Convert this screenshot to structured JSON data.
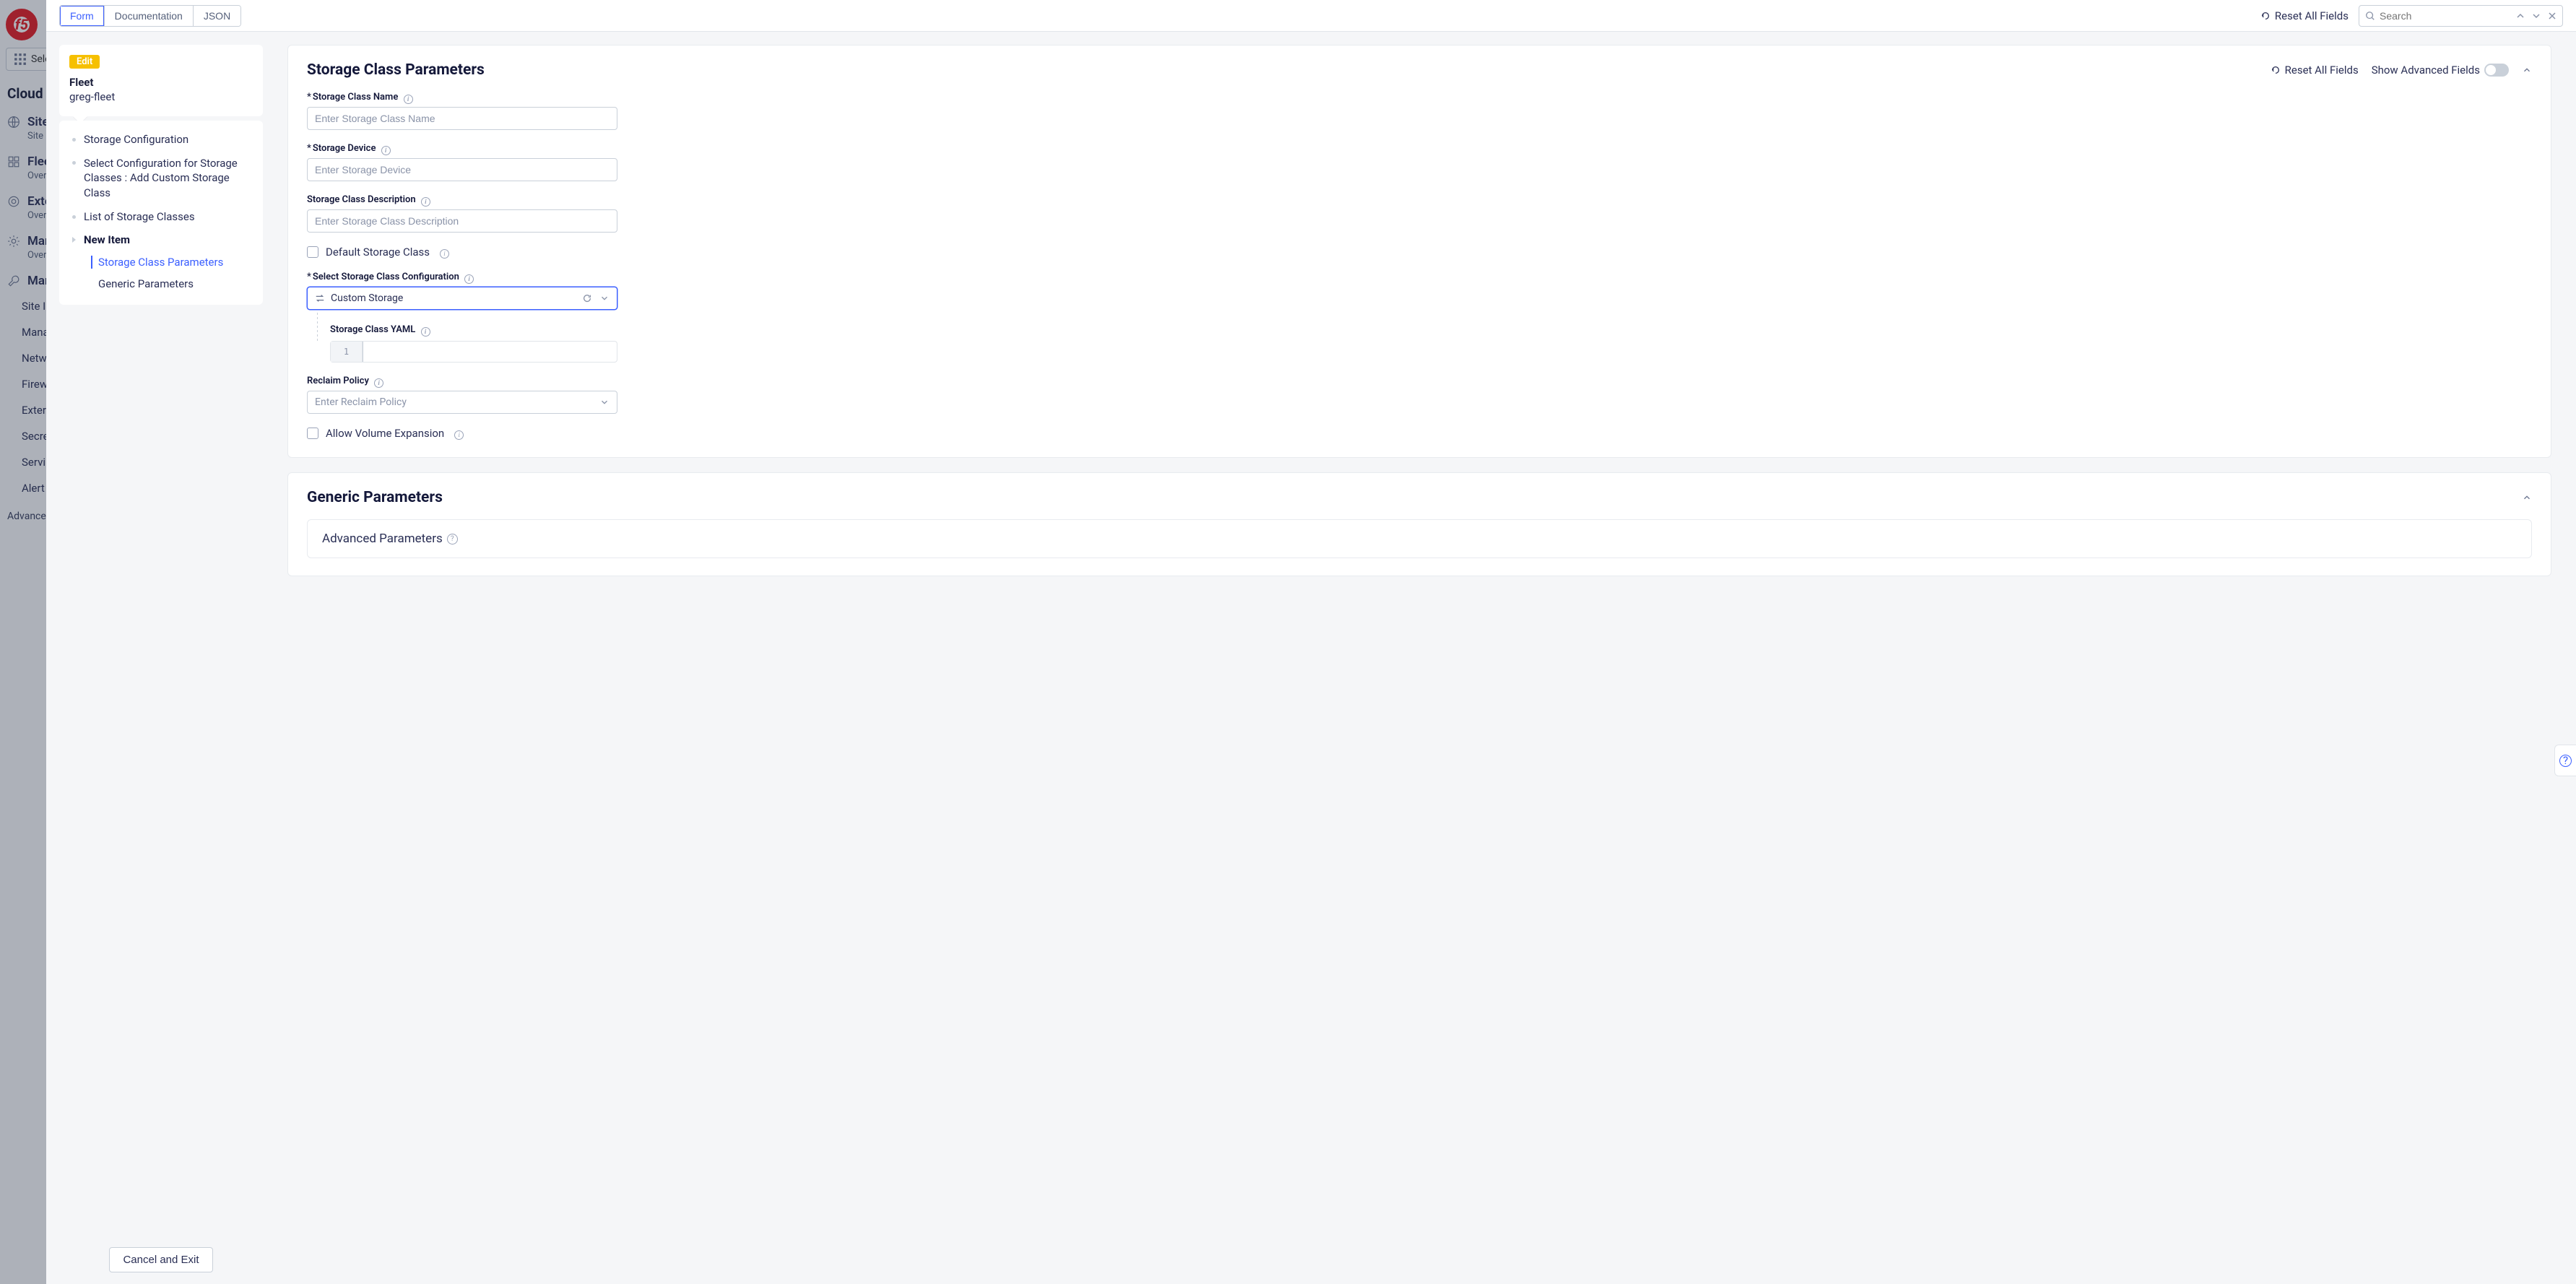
{
  "bg": {
    "select_label": "Sele",
    "heading": "Cloud a",
    "nav": [
      {
        "label": "Sites",
        "sub": "Site M"
      },
      {
        "label": "Flee",
        "sub": "Overv"
      },
      {
        "label": "Exte",
        "sub": "Overv"
      },
      {
        "label": "Man",
        "sub": "Overv"
      },
      {
        "label": "Man",
        "sub": ""
      }
    ],
    "plain": [
      "Site I",
      "Mana",
      "Netw",
      "Firew",
      "Exter",
      "Secre",
      "Servi",
      "Alert"
    ],
    "footer": "Advanced"
  },
  "toolbar": {
    "tabs": {
      "form": "Form",
      "documentation": "Documentation",
      "json": "JSON"
    },
    "reset": "Reset All Fields",
    "search_placeholder": "Search"
  },
  "tree": {
    "badge": "Edit",
    "title": "Fleet",
    "subtitle": "greg-fleet",
    "items": {
      "storage_config": "Storage Configuration",
      "select_config": "Select Configuration for Storage Classes : Add Custom Storage Class",
      "list_classes": "List of Storage Classes",
      "new_item": "New Item",
      "sub_params": "Storage Class Parameters",
      "sub_generic": "Generic Parameters"
    },
    "cancel": "Cancel and Exit"
  },
  "form": {
    "section_title": "Storage Class Parameters",
    "reset": "Reset All Fields",
    "show_advanced": "Show Advanced Fields",
    "fields": {
      "name": {
        "label": "Storage Class Name",
        "placeholder": "Enter Storage Class Name",
        "required": true
      },
      "device": {
        "label": "Storage Device",
        "placeholder": "Enter Storage Device",
        "required": true
      },
      "description": {
        "label": "Storage Class Description",
        "placeholder": "Enter Storage Class Description",
        "required": false
      },
      "default_class": {
        "label": "Default Storage Class"
      },
      "select_config": {
        "label": "Select Storage Class Configuration",
        "value": "Custom Storage",
        "required": true
      },
      "yaml": {
        "label": "Storage Class YAML",
        "line": "1"
      },
      "reclaim": {
        "label": "Reclaim Policy",
        "placeholder": "Enter Reclaim Policy"
      },
      "allow_expansion": {
        "label": "Allow Volume Expansion"
      }
    },
    "generic": {
      "title": "Generic Parameters",
      "advanced": "Advanced Parameters"
    }
  }
}
